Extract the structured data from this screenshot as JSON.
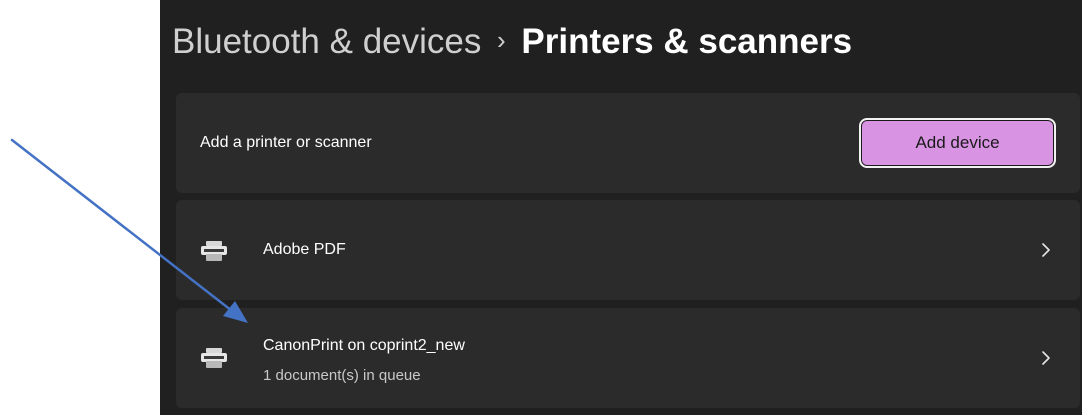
{
  "breadcrumb": {
    "parent": "Bluetooth & devices",
    "separator": "›",
    "current": "Printers & scanners"
  },
  "add_section": {
    "label": "Add a printer or scanner",
    "button_label": "Add device",
    "button_color": "#d993e3"
  },
  "printers": [
    {
      "name": "Adobe PDF",
      "status": "",
      "icon": "printer-icon"
    },
    {
      "name": "CanonPrint on coprint2_new",
      "status": "1 document(s) in queue",
      "icon": "printer-icon"
    }
  ],
  "annotation": {
    "arrow_color": "#4472c4"
  },
  "colors": {
    "panel_background": "#202020",
    "card_background": "#2b2b2b"
  }
}
